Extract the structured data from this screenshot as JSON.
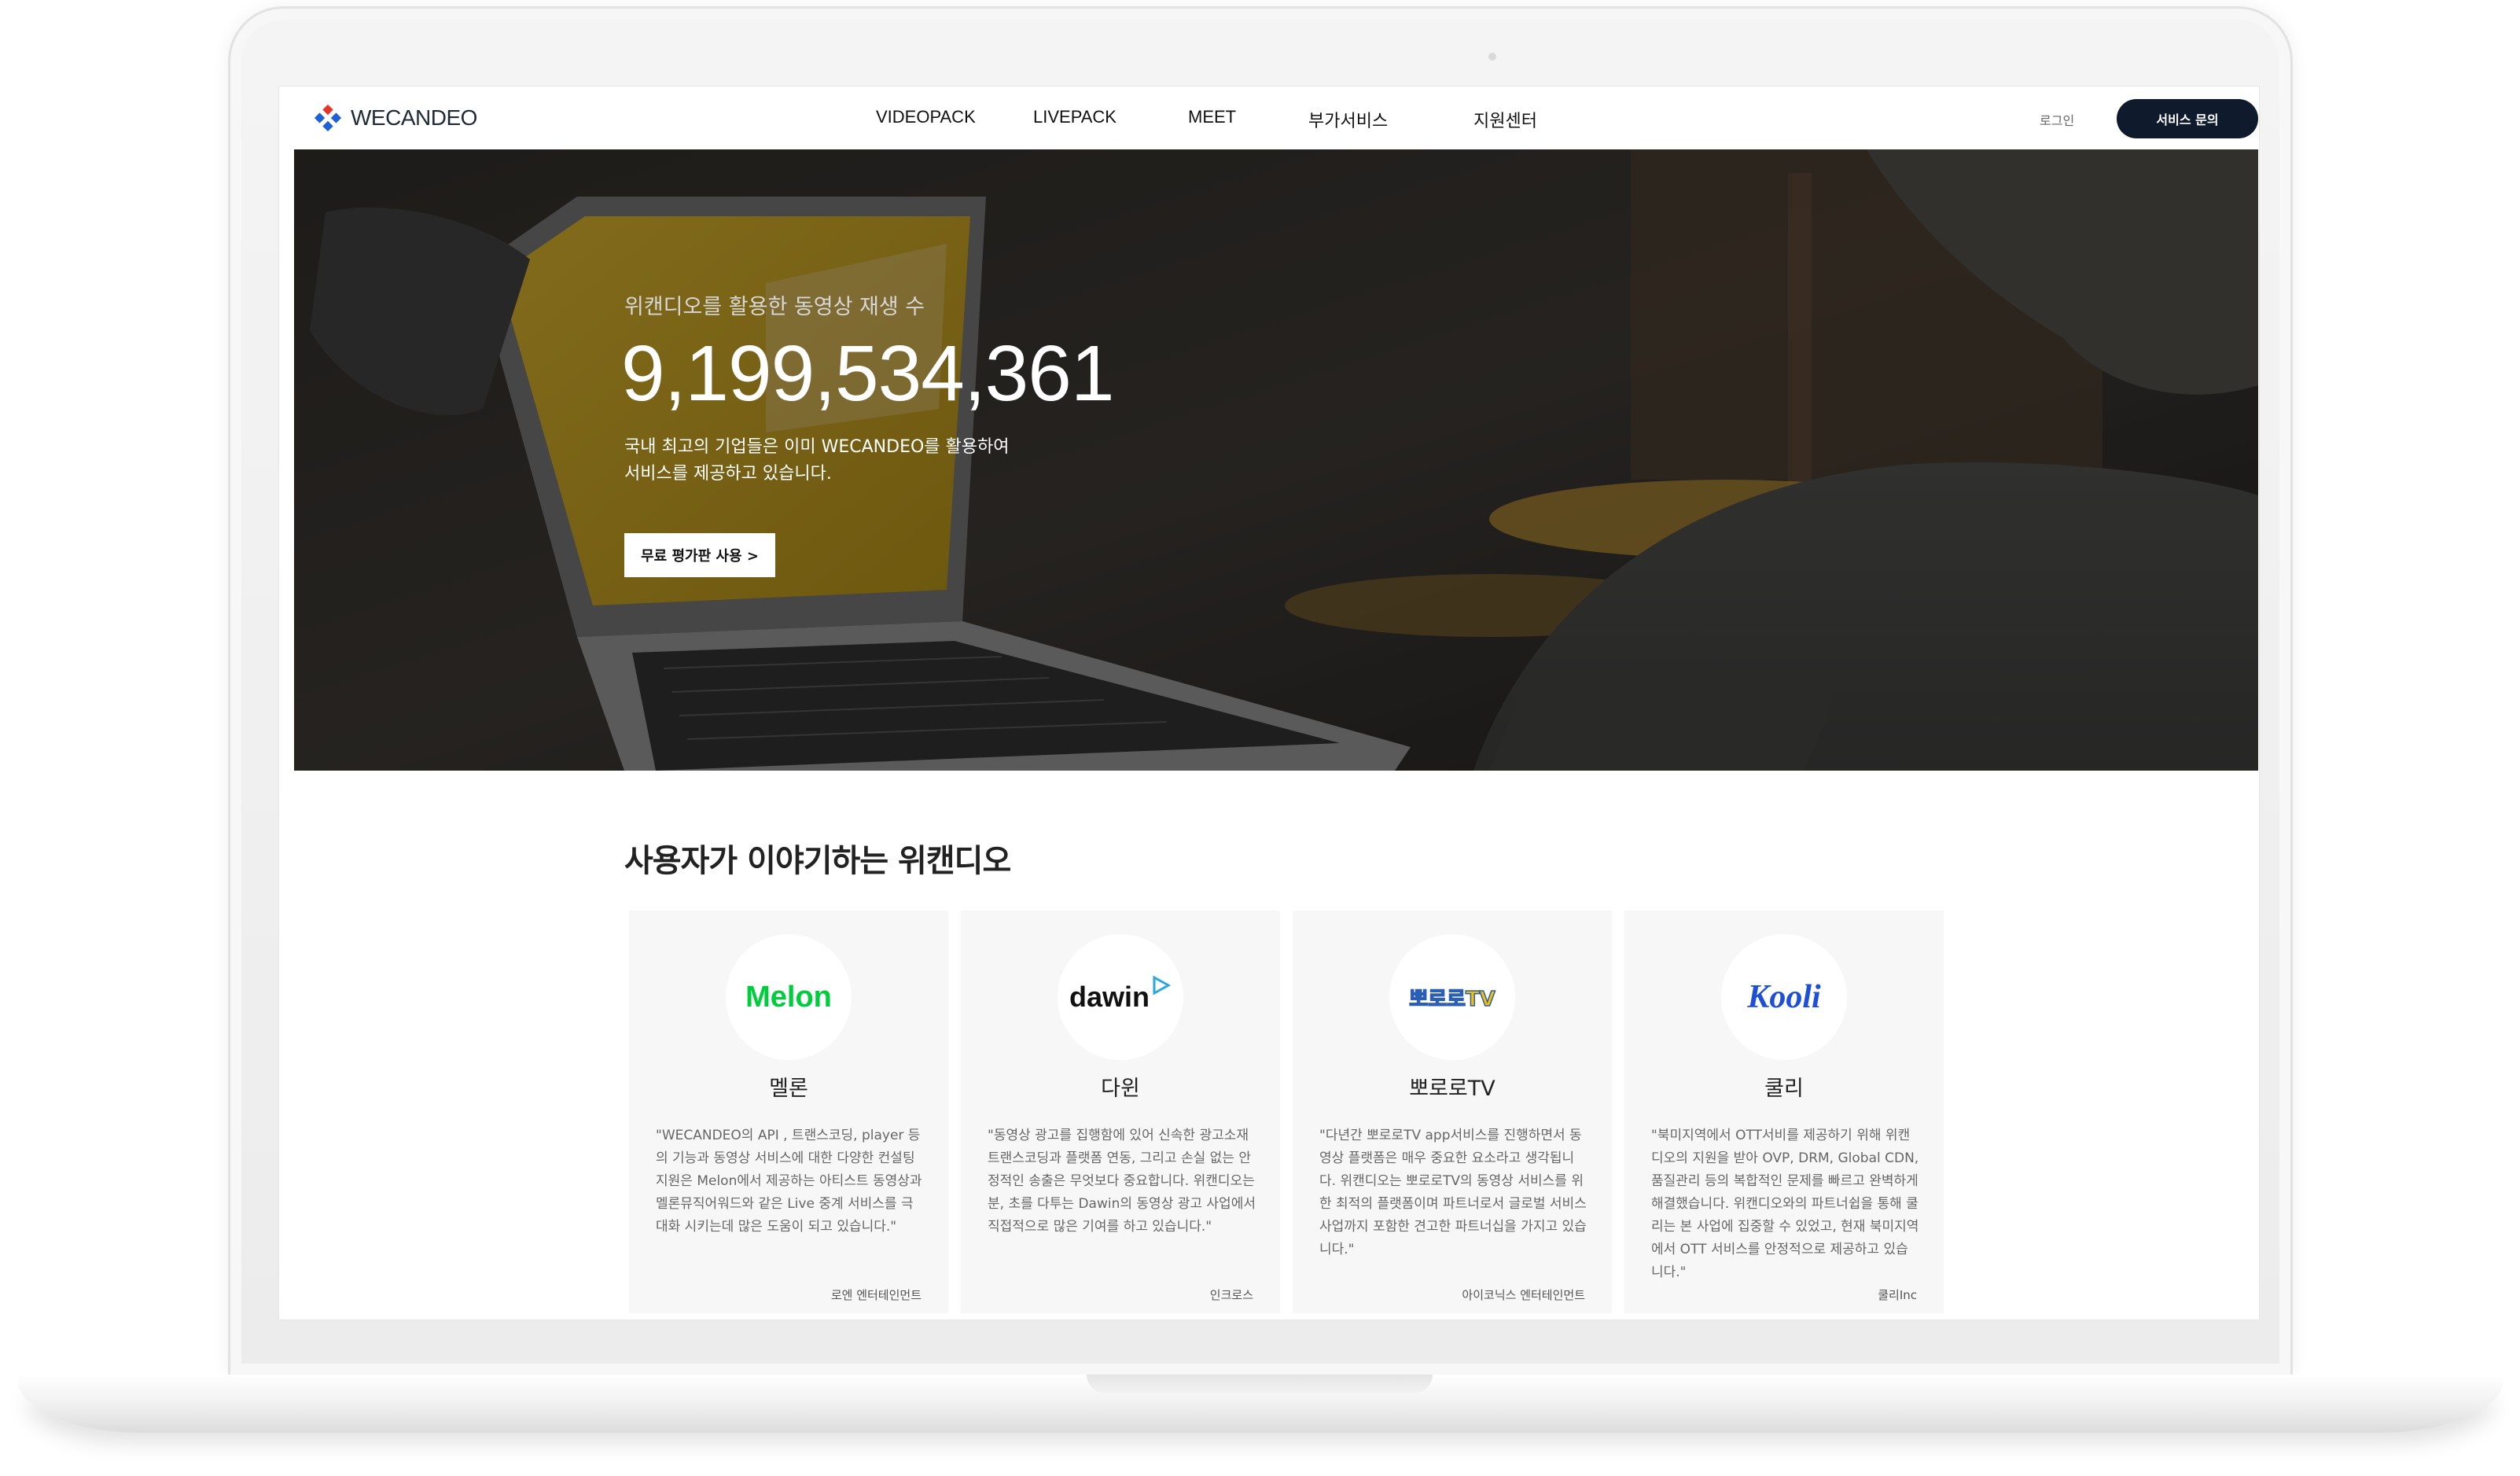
{
  "brand": {
    "name": "WECANDEO",
    "accent": "#0f1a2c"
  },
  "nav": {
    "items": [
      "VIDEOPACK",
      "LIVEPACK",
      "MEET",
      "부가서비스",
      "지원센터"
    ],
    "login": "로그인",
    "cta": "서비스 문의"
  },
  "hero": {
    "subtitle": "위캔디오를 활용한 동영상 재생 수",
    "count": "9,199,534,361",
    "desc_line1": "국내 최고의 기업들은 이미 WECANDEO를 활용하여",
    "desc_line2": "서비스를 제공하고 있습니다.",
    "button": "무료 평가판 사용 >"
  },
  "testimonials": {
    "title": "사용자가 이야기하는 위캔디오",
    "cards": [
      {
        "logo": "Melon",
        "logo_color": "#00cd3c",
        "name": "멜론",
        "quote": "\"WECANDEO의 API , 트랜스코딩, player 등의 기능과 동영상 서비스에 대한 다양한 컨설팅 지원은 Melon에서 제공하는 아티스트 동영상과 멜론뮤직어워드와 같은 Live 중계 서비스를 극대화 시키는데 많은 도움이 되고 있습니다.\"",
        "company": "로엔 엔터테인먼트"
      },
      {
        "logo": "dawin",
        "logo_color": "#111111",
        "name": "다윈",
        "quote": "\"동영상 광고를 집행함에 있어 신속한 광고소재 트랜스코딩과 플랫폼 연동, 그리고 손실 없는 안정적인 송출은 무엇보다 중요합니다. 위캔디오는 분, 초를 다투는 Dawin의 동영상 광고 사업에서 직접적으로 많은 기여를 하고 있습니다.\"",
        "company": "인크로스"
      },
      {
        "logo": "뽀로로TV",
        "logo_color": "#f6c000",
        "name": "뽀로로TV",
        "quote": "\"다년간 뽀로로TV app서비스를 진행하면서 동영상 플랫폼은 매우 중요한 요소라고 생각됩니다. 위캔디오는 뽀로로TV의 동영상 서비스를 위한 최적의 플랫폼이며 파트너로서 글로벌 서비스 사업까지 포함한 견고한 파트너십을 가지고 있습니다.\"",
        "company": "아이코닉스 엔터테인먼트"
      },
      {
        "logo": "Kooli",
        "logo_color": "#1e4fd8",
        "name": "쿨리",
        "quote": "\"북미지역에서 OTT서비를 제공하기 위해 위캔디오의 지원을 받아 OVP, DRM, Global CDN, 품질관리 등의 복합적인 문제를 빠르고 완벽하게 해결했습니다. 위캔디오와의 파트너쉽을 통해 쿨리는 본 사업에 집중할 수 있었고, 현재 북미지역에서 OTT 서비스를 안정적으로 제공하고 있습니다.\"",
        "company": "쿨리Inc"
      }
    ]
  }
}
